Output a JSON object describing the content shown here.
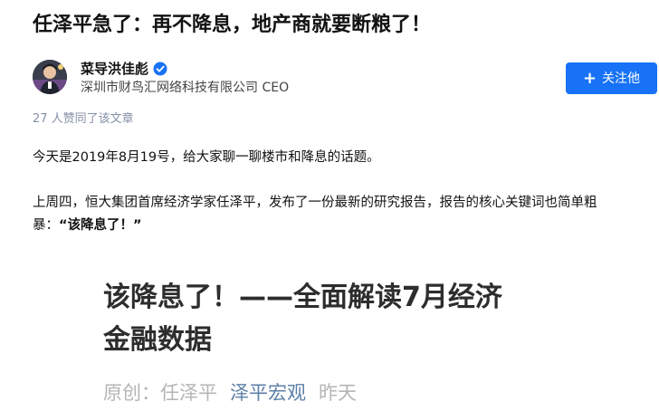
{
  "article": {
    "title": "任泽平急了：再不降息，地产商就要断粮了！"
  },
  "author": {
    "name": "菜导洪佳彪",
    "description": "深圳市财鸟汇网络科技有限公司 CEO",
    "follow_label": "关注他",
    "verified_icon": "verified-badge-icon"
  },
  "likes_text": "27 人赞同了该文章",
  "content": {
    "para1": "今天是2019年8月19号，给大家聊一聊楼市和降息的话题。",
    "para2_line1": "上周四，恒大集团首席经济学家任泽平，发布了一份最新的研究报告，报告的核心关键词也简单粗",
    "para2_line2_prefix": "暴：",
    "para2_quote": "“该降息了！”"
  },
  "figure": {
    "title_line1": "该降息了！——全面解读7月经济",
    "title_line2": "金融数据",
    "meta_prefix": "原创：任泽平",
    "meta_brand": "泽平宏观",
    "meta_time": "昨天"
  },
  "colors": {
    "accent": "#1772f6",
    "muted": "#8590a6",
    "brand_link": "#5d7fa8"
  }
}
